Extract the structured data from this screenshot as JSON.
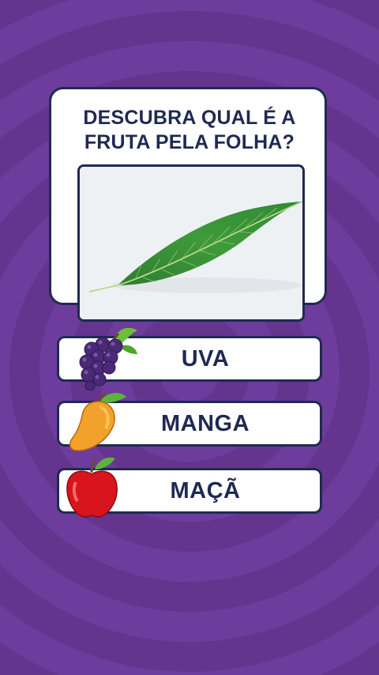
{
  "quiz": {
    "question": "DESCUBRA QUAL É A FRUTA PELA FOLHA?",
    "image": "mango-leaf",
    "options": [
      {
        "label": "UVA",
        "icon": "grapes-icon"
      },
      {
        "label": "MANGA",
        "icon": "mango-icon"
      },
      {
        "label": "MAÇÃ",
        "icon": "apple-icon"
      }
    ]
  },
  "colors": {
    "background": "#6b3a98",
    "card": "#ffffff",
    "outline_text": "#1f2a52"
  }
}
